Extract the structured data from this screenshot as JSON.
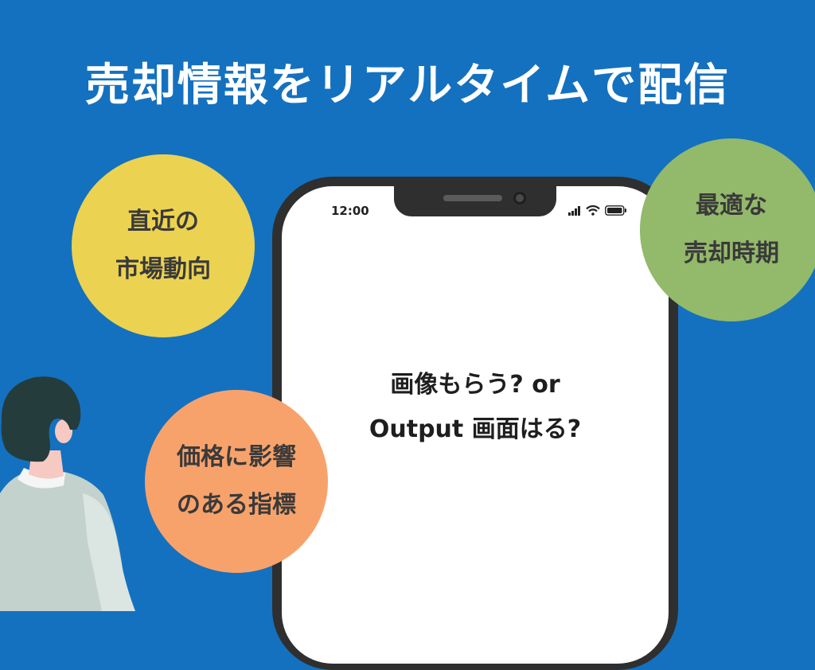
{
  "headline": "売却情報をリアルタイムで配信",
  "bubbles": {
    "market_trend": {
      "line1": "直近の",
      "line2": "市場動向"
    },
    "best_timing": {
      "line1": "最適な",
      "line2": "売却時期"
    },
    "price_indicators": {
      "line1": "価格に影響",
      "line2": "のある指標"
    }
  },
  "phone": {
    "status_time": "12:00",
    "screen_line1": "画像もらう? or",
    "screen_line2": "Output 画面はる?"
  },
  "colors": {
    "background": "#1471bf",
    "bubble_yellow": "#ecd251",
    "bubble_green": "#93b96b",
    "bubble_orange": "#f8a26b"
  },
  "icons": [
    "signal-icon",
    "wifi-icon",
    "battery-icon"
  ]
}
